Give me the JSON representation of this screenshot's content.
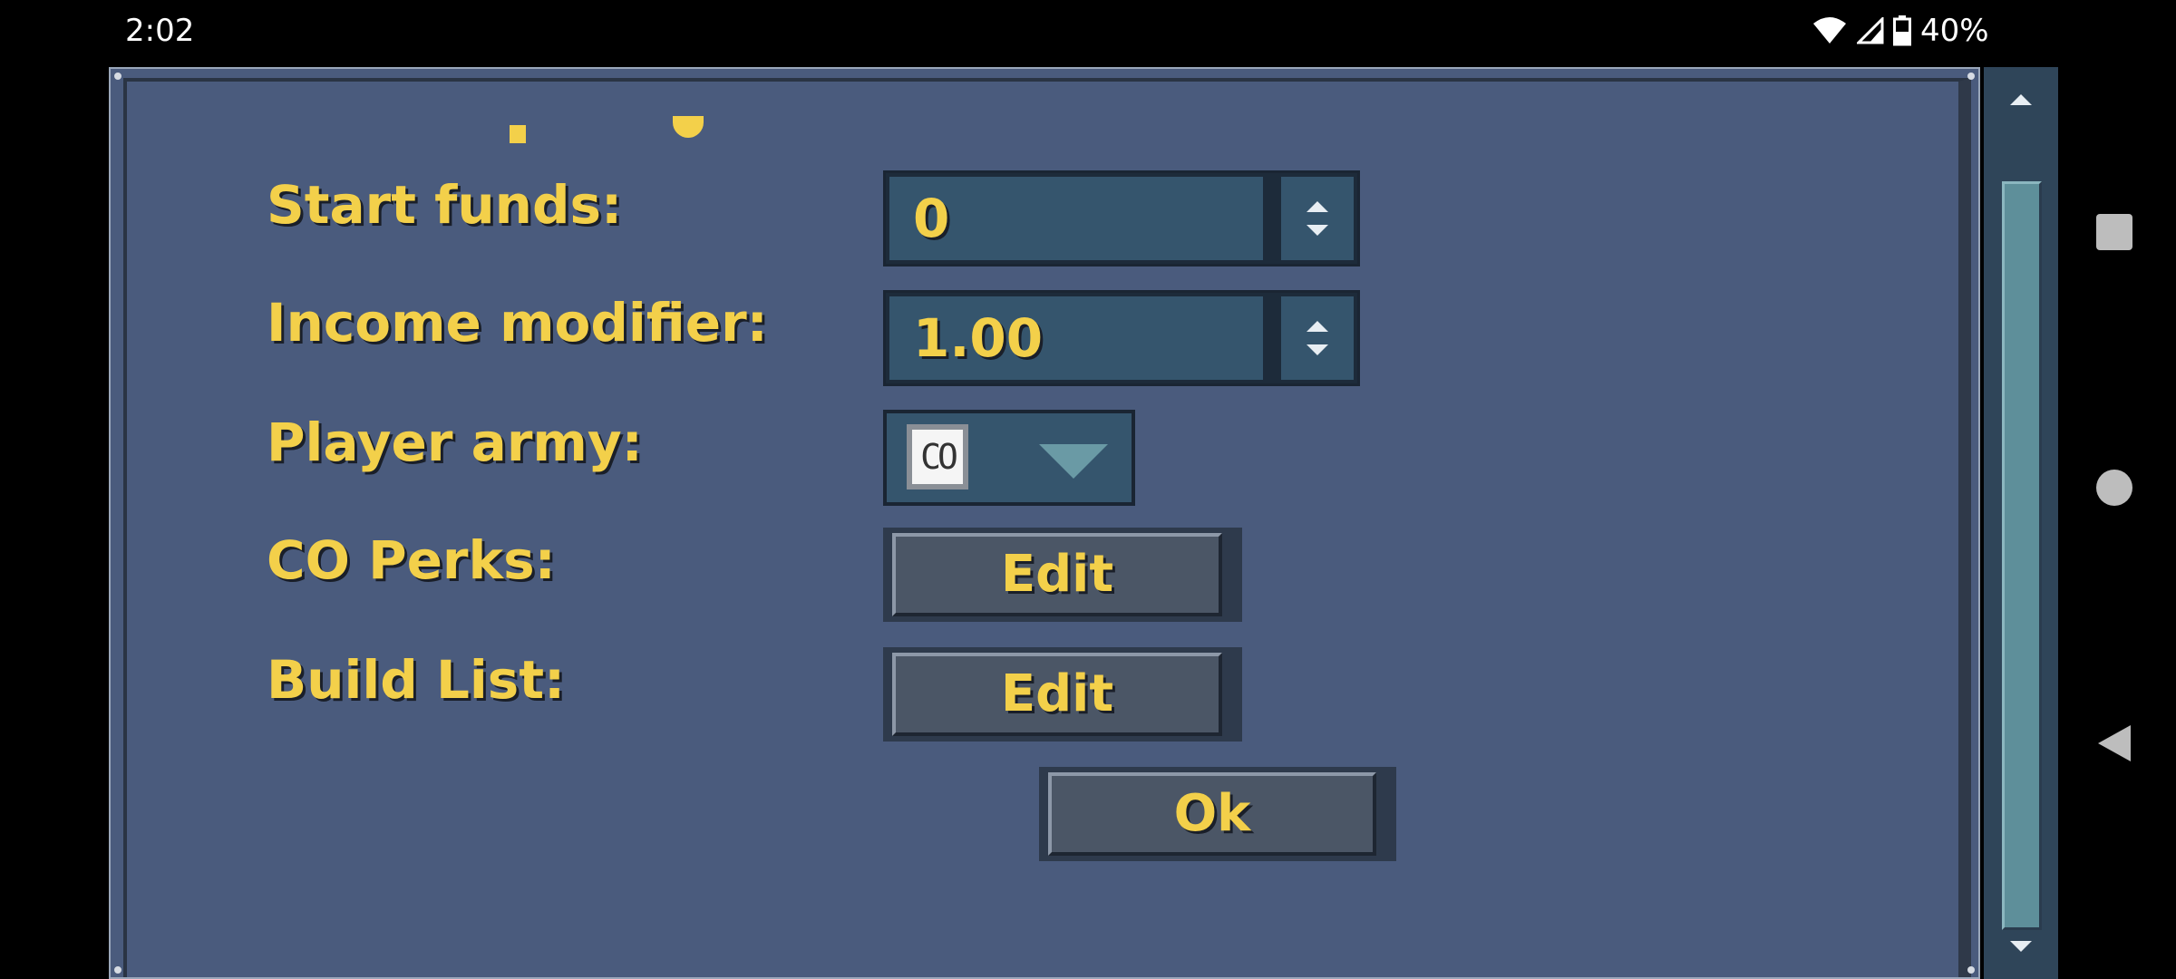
{
  "status_bar": {
    "time": "2:02",
    "battery_percent": "40%",
    "icons": [
      "wifi-icon",
      "cell-signal-icon",
      "battery-icon"
    ]
  },
  "form": {
    "start_funds": {
      "label": "Start funds:",
      "value": "0"
    },
    "income_modifier": {
      "label": "Income modifier:",
      "value": "1.00"
    },
    "player_army": {
      "label": "Player army:",
      "selected": "CO"
    },
    "co_perks": {
      "label": "CO Perks:",
      "button": "Edit"
    },
    "build_list": {
      "label": "Build List:",
      "button": "Edit"
    },
    "ok_button": "Ok"
  },
  "nav_bar": {
    "icons": [
      "recents-square-icon",
      "home-circle-icon",
      "back-triangle-icon"
    ]
  },
  "colors": {
    "panel": "#4a5b7d",
    "label_text": "#f3d04a",
    "input_bg": "#35556d",
    "button_bg": "#4b5666",
    "scroll_thumb": "#5e8f9a"
  }
}
